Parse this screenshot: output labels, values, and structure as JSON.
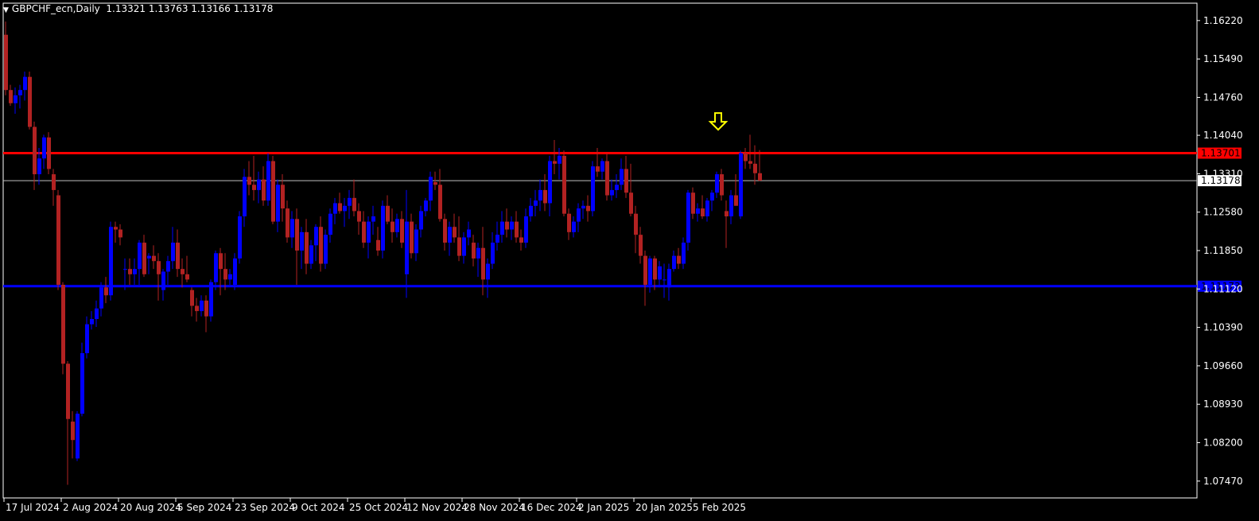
{
  "header": {
    "symbol": "GBPCHF_ecn,Daily",
    "ohlc": "1.13321 1.13763 1.13166 1.13178"
  },
  "colors": {
    "background": "#000000",
    "bull": "#0000ff",
    "bear": "#b22222",
    "resistance": "#ff0000",
    "support": "#0000ff",
    "current_price": "#c0c0c0",
    "arrow": "#ffff00",
    "axis": "#ffffff"
  },
  "chart_data": {
    "type": "candlestick",
    "symbol": "GBPCHF_ecn",
    "timeframe": "Daily",
    "ylim": [
      1.0715,
      1.1655
    ],
    "yticks": [
      "1.16220",
      "1.15490",
      "1.14760",
      "1.14040",
      "1.13310",
      "1.12580",
      "1.11850",
      "1.11120",
      "1.10390",
      "1.09660",
      "1.08930",
      "1.08200",
      "1.07470"
    ],
    "xticks": [
      {
        "label": "17 Jul 2024",
        "index": 0
      },
      {
        "label": "2 Aug 2024",
        "index": 12
      },
      {
        "label": "20 Aug 2024",
        "index": 24
      },
      {
        "label": "5 Sep 2024",
        "index": 36
      },
      {
        "label": "23 Sep 2024",
        "index": 48
      },
      {
        "label": "9 Oct 2024",
        "index": 60
      },
      {
        "label": "25 Oct 2024",
        "index": 72
      },
      {
        "label": "12 Nov 2024",
        "index": 84
      },
      {
        "label": "28 Nov 2024",
        "index": 96
      },
      {
        "label": "16 Dec 2024",
        "index": 108
      },
      {
        "label": "2 Jan 2025",
        "index": 120
      },
      {
        "label": "20 Jan 2025",
        "index": 132
      },
      {
        "label": "5 Feb 2025",
        "index": 144
      }
    ],
    "hlines": [
      {
        "name": "resistance",
        "value": 1.13701,
        "label": "1.13701"
      },
      {
        "name": "current",
        "value": 1.13178,
        "label": "1.13178"
      },
      {
        "name": "support",
        "value": 1.11173,
        "label": "1.11173"
      }
    ],
    "arrow": {
      "index": 149,
      "price": 1.141
    },
    "candles": [
      [
        1.1595,
        1.162,
        1.148,
        1.149
      ],
      [
        1.149,
        1.15,
        1.146,
        1.1465
      ],
      [
        1.1465,
        1.1495,
        1.1445,
        1.148
      ],
      [
        1.148,
        1.15,
        1.1455,
        1.149
      ],
      [
        1.149,
        1.1525,
        1.147,
        1.1515
      ],
      [
        1.1515,
        1.1525,
        1.1415,
        1.142
      ],
      [
        1.142,
        1.143,
        1.13,
        1.133
      ],
      [
        1.133,
        1.138,
        1.131,
        1.136
      ],
      [
        1.136,
        1.1405,
        1.134,
        1.14
      ],
      [
        1.14,
        1.141,
        1.133,
        1.134
      ],
      [
        1.133,
        1.134,
        1.127,
        1.13
      ],
      [
        1.129,
        1.13,
        1.111,
        1.112
      ],
      [
        1.112,
        1.1125,
        1.095,
        1.097
      ],
      [
        1.097,
        1.0975,
        1.074,
        1.0865
      ],
      [
        1.086,
        1.088,
        1.079,
        1.0825
      ],
      [
        1.079,
        1.088,
        1.0785,
        1.0875
      ],
      [
        1.0875,
        1.101,
        1.087,
        1.099
      ],
      [
        1.099,
        1.106,
        1.098,
        1.1045
      ],
      [
        1.1045,
        1.107,
        1.1035,
        1.1055
      ],
      [
        1.1055,
        1.109,
        1.104,
        1.1075
      ],
      [
        1.1075,
        1.1125,
        1.106,
        1.1115
      ],
      [
        1.1115,
        1.1135,
        1.1085,
        1.11
      ],
      [
        1.11,
        1.124,
        1.109,
        1.123
      ],
      [
        1.123,
        1.124,
        1.12,
        1.1225
      ],
      [
        1.1225,
        1.1235,
        1.1195,
        1.121
      ],
      [
        1.115,
        1.117,
        1.111,
        1.115
      ],
      [
        1.115,
        1.117,
        1.112,
        1.114
      ],
      [
        1.114,
        1.117,
        1.112,
        1.115
      ],
      [
        1.115,
        1.1205,
        1.112,
        1.12
      ],
      [
        1.12,
        1.1215,
        1.1135,
        1.114
      ],
      [
        1.117,
        1.118,
        1.114,
        1.1175
      ],
      [
        1.1175,
        1.1195,
        1.115,
        1.1165
      ],
      [
        1.1165,
        1.118,
        1.109,
        1.114
      ],
      [
        1.111,
        1.115,
        1.109,
        1.1145
      ],
      [
        1.1145,
        1.1175,
        1.112,
        1.1165
      ],
      [
        1.1165,
        1.123,
        1.115,
        1.12
      ],
      [
        1.12,
        1.1225,
        1.1135,
        1.115
      ],
      [
        1.115,
        1.117,
        1.1115,
        1.114
      ],
      [
        1.114,
        1.1175,
        1.1125,
        1.113
      ],
      [
        1.111,
        1.1115,
        1.106,
        1.108
      ],
      [
        1.108,
        1.1095,
        1.105,
        1.107
      ],
      [
        1.107,
        1.11,
        1.106,
        1.109
      ],
      [
        1.109,
        1.11,
        1.103,
        1.106
      ],
      [
        1.106,
        1.113,
        1.105,
        1.1125
      ],
      [
        1.1125,
        1.1185,
        1.111,
        1.118
      ],
      [
        1.118,
        1.119,
        1.11,
        1.115
      ],
      [
        1.115,
        1.118,
        1.111,
        1.113
      ],
      [
        1.113,
        1.115,
        1.112,
        1.114
      ],
      [
        1.112,
        1.118,
        1.111,
        1.117
      ],
      [
        1.117,
        1.126,
        1.116,
        1.125
      ],
      [
        1.125,
        1.134,
        1.123,
        1.1325
      ],
      [
        1.1325,
        1.1355,
        1.129,
        1.131
      ],
      [
        1.131,
        1.1365,
        1.128,
        1.13
      ],
      [
        1.13,
        1.1335,
        1.1275,
        1.132
      ],
      [
        1.132,
        1.1345,
        1.127,
        1.128
      ],
      [
        1.128,
        1.137,
        1.127,
        1.1355
      ],
      [
        1.1355,
        1.1365,
        1.1235,
        1.124
      ],
      [
        1.124,
        1.132,
        1.122,
        1.131
      ],
      [
        1.131,
        1.133,
        1.124,
        1.1265
      ],
      [
        1.1265,
        1.128,
        1.12,
        1.121
      ],
      [
        1.121,
        1.126,
        1.119,
        1.1245
      ],
      [
        1.1245,
        1.1265,
        1.112,
        1.1185
      ],
      [
        1.1185,
        1.123,
        1.115,
        1.122
      ],
      [
        1.122,
        1.1245,
        1.114,
        1.116
      ],
      [
        1.116,
        1.1205,
        1.115,
        1.1195
      ],
      [
        1.1195,
        1.1235,
        1.1165,
        1.123
      ],
      [
        1.123,
        1.125,
        1.1145,
        1.116
      ],
      [
        1.116,
        1.1225,
        1.115,
        1.1215
      ],
      [
        1.1215,
        1.1265,
        1.12,
        1.1255
      ],
      [
        1.1255,
        1.1285,
        1.1235,
        1.1275
      ],
      [
        1.1275,
        1.1295,
        1.1255,
        1.126
      ],
      [
        1.126,
        1.1285,
        1.123,
        1.127
      ],
      [
        1.127,
        1.13,
        1.1245,
        1.1285
      ],
      [
        1.1285,
        1.132,
        1.125,
        1.126
      ],
      [
        1.126,
        1.1275,
        1.1215,
        1.124
      ],
      [
        1.124,
        1.126,
        1.119,
        1.12
      ],
      [
        1.12,
        1.125,
        1.117,
        1.124
      ],
      [
        1.124,
        1.127,
        1.1215,
        1.125
      ],
      [
        1.1205,
        1.123,
        1.1175,
        1.1185
      ],
      [
        1.1185,
        1.128,
        1.117,
        1.127
      ],
      [
        1.127,
        1.129,
        1.1235,
        1.124
      ],
      [
        1.124,
        1.1265,
        1.12,
        1.122
      ],
      [
        1.122,
        1.1255,
        1.121,
        1.1245
      ],
      [
        1.1245,
        1.126,
        1.119,
        1.12
      ],
      [
        1.114,
        1.13,
        1.1095,
        1.124
      ],
      [
        1.124,
        1.1255,
        1.117,
        1.118
      ],
      [
        1.118,
        1.1235,
        1.1165,
        1.1225
      ],
      [
        1.1225,
        1.127,
        1.121,
        1.126
      ],
      [
        1.126,
        1.1285,
        1.125,
        1.128
      ],
      [
        1.128,
        1.1335,
        1.126,
        1.1325
      ],
      [
        1.1315,
        1.1335,
        1.13,
        1.131
      ],
      [
        1.131,
        1.134,
        1.124,
        1.1245
      ],
      [
        1.1245,
        1.1255,
        1.1185,
        1.12
      ],
      [
        1.12,
        1.124,
        1.1175,
        1.123
      ],
      [
        1.123,
        1.1255,
        1.12,
        1.121
      ],
      [
        1.121,
        1.125,
        1.1165,
        1.1175
      ],
      [
        1.1175,
        1.122,
        1.116,
        1.121
      ],
      [
        1.121,
        1.124,
        1.1195,
        1.1225
      ],
      [
        1.12,
        1.1215,
        1.1155,
        1.117
      ],
      [
        1.117,
        1.12,
        1.1135,
        1.119
      ],
      [
        1.119,
        1.123,
        1.11,
        1.113
      ],
      [
        1.113,
        1.117,
        1.1095,
        1.116
      ],
      [
        1.116,
        1.122,
        1.115,
        1.12
      ],
      [
        1.12,
        1.124,
        1.1185,
        1.1215
      ],
      [
        1.1215,
        1.126,
        1.12,
        1.124
      ],
      [
        1.124,
        1.1265,
        1.121,
        1.1225
      ],
      [
        1.1225,
        1.125,
        1.1205,
        1.124
      ],
      [
        1.124,
        1.126,
        1.12,
        1.121
      ],
      [
        1.121,
        1.1225,
        1.1185,
        1.12
      ],
      [
        1.12,
        1.1265,
        1.119,
        1.125
      ],
      [
        1.125,
        1.1285,
        1.124,
        1.127
      ],
      [
        1.127,
        1.13,
        1.125,
        1.128
      ],
      [
        1.128,
        1.132,
        1.126,
        1.13
      ],
      [
        1.13,
        1.133,
        1.126,
        1.1275
      ],
      [
        1.1275,
        1.1365,
        1.125,
        1.1355
      ],
      [
        1.1355,
        1.1395,
        1.133,
        1.135
      ],
      [
        1.135,
        1.138,
        1.132,
        1.1365
      ],
      [
        1.1365,
        1.1375,
        1.125,
        1.1255
      ],
      [
        1.1255,
        1.1265,
        1.1205,
        1.122
      ],
      [
        1.122,
        1.125,
        1.121,
        1.124
      ],
      [
        1.124,
        1.1275,
        1.122,
        1.1265
      ],
      [
        1.1265,
        1.128,
        1.1245,
        1.127
      ],
      [
        1.127,
        1.129,
        1.124,
        1.126
      ],
      [
        1.126,
        1.1355,
        1.125,
        1.1345
      ],
      [
        1.1345,
        1.138,
        1.1325,
        1.1335
      ],
      [
        1.1335,
        1.136,
        1.132,
        1.1355
      ],
      [
        1.1355,
        1.137,
        1.128,
        1.129
      ],
      [
        1.129,
        1.132,
        1.128,
        1.13
      ],
      [
        1.13,
        1.133,
        1.1285,
        1.131
      ],
      [
        1.131,
        1.136,
        1.13,
        1.134
      ],
      [
        1.134,
        1.1365,
        1.1285,
        1.1295
      ],
      [
        1.1295,
        1.135,
        1.125,
        1.1255
      ],
      [
        1.1255,
        1.127,
        1.118,
        1.1215
      ],
      [
        1.1215,
        1.123,
        1.116,
        1.1175
      ],
      [
        1.1175,
        1.1185,
        1.108,
        1.112
      ],
      [
        1.112,
        1.1175,
        1.1105,
        1.117
      ],
      [
        1.117,
        1.1175,
        1.111,
        1.113
      ],
      [
        1.113,
        1.1165,
        1.1115,
        1.1155
      ],
      [
        1.113,
        1.116,
        1.1095,
        1.113
      ],
      [
        1.1115,
        1.116,
        1.109,
        1.115
      ],
      [
        1.115,
        1.1185,
        1.1145,
        1.1175
      ],
      [
        1.1175,
        1.119,
        1.115,
        1.116
      ],
      [
        1.116,
        1.121,
        1.115,
        1.12
      ],
      [
        1.12,
        1.13,
        1.1185,
        1.1295
      ],
      [
        1.1295,
        1.1305,
        1.1245,
        1.1255
      ],
      [
        1.1255,
        1.1275,
        1.124,
        1.1265
      ],
      [
        1.1265,
        1.129,
        1.1245,
        1.125
      ],
      [
        1.125,
        1.1285,
        1.124,
        1.128
      ],
      [
        1.128,
        1.13,
        1.126,
        1.1295
      ],
      [
        1.1295,
        1.1335,
        1.1285,
        1.133
      ],
      [
        1.133,
        1.134,
        1.128,
        1.129
      ],
      [
        1.126,
        1.128,
        1.119,
        1.125
      ],
      [
        1.125,
        1.13,
        1.1235,
        1.129
      ],
      [
        1.129,
        1.133,
        1.128,
        1.127
      ],
      [
        1.125,
        1.1375,
        1.1245,
        1.137
      ],
      [
        1.137,
        1.138,
        1.134,
        1.1355
      ],
      [
        1.1355,
        1.1405,
        1.134,
        1.135
      ],
      [
        1.135,
        1.1385,
        1.131,
        1.1332
      ],
      [
        1.1332,
        1.1376,
        1.1317,
        1.1318
      ]
    ]
  }
}
